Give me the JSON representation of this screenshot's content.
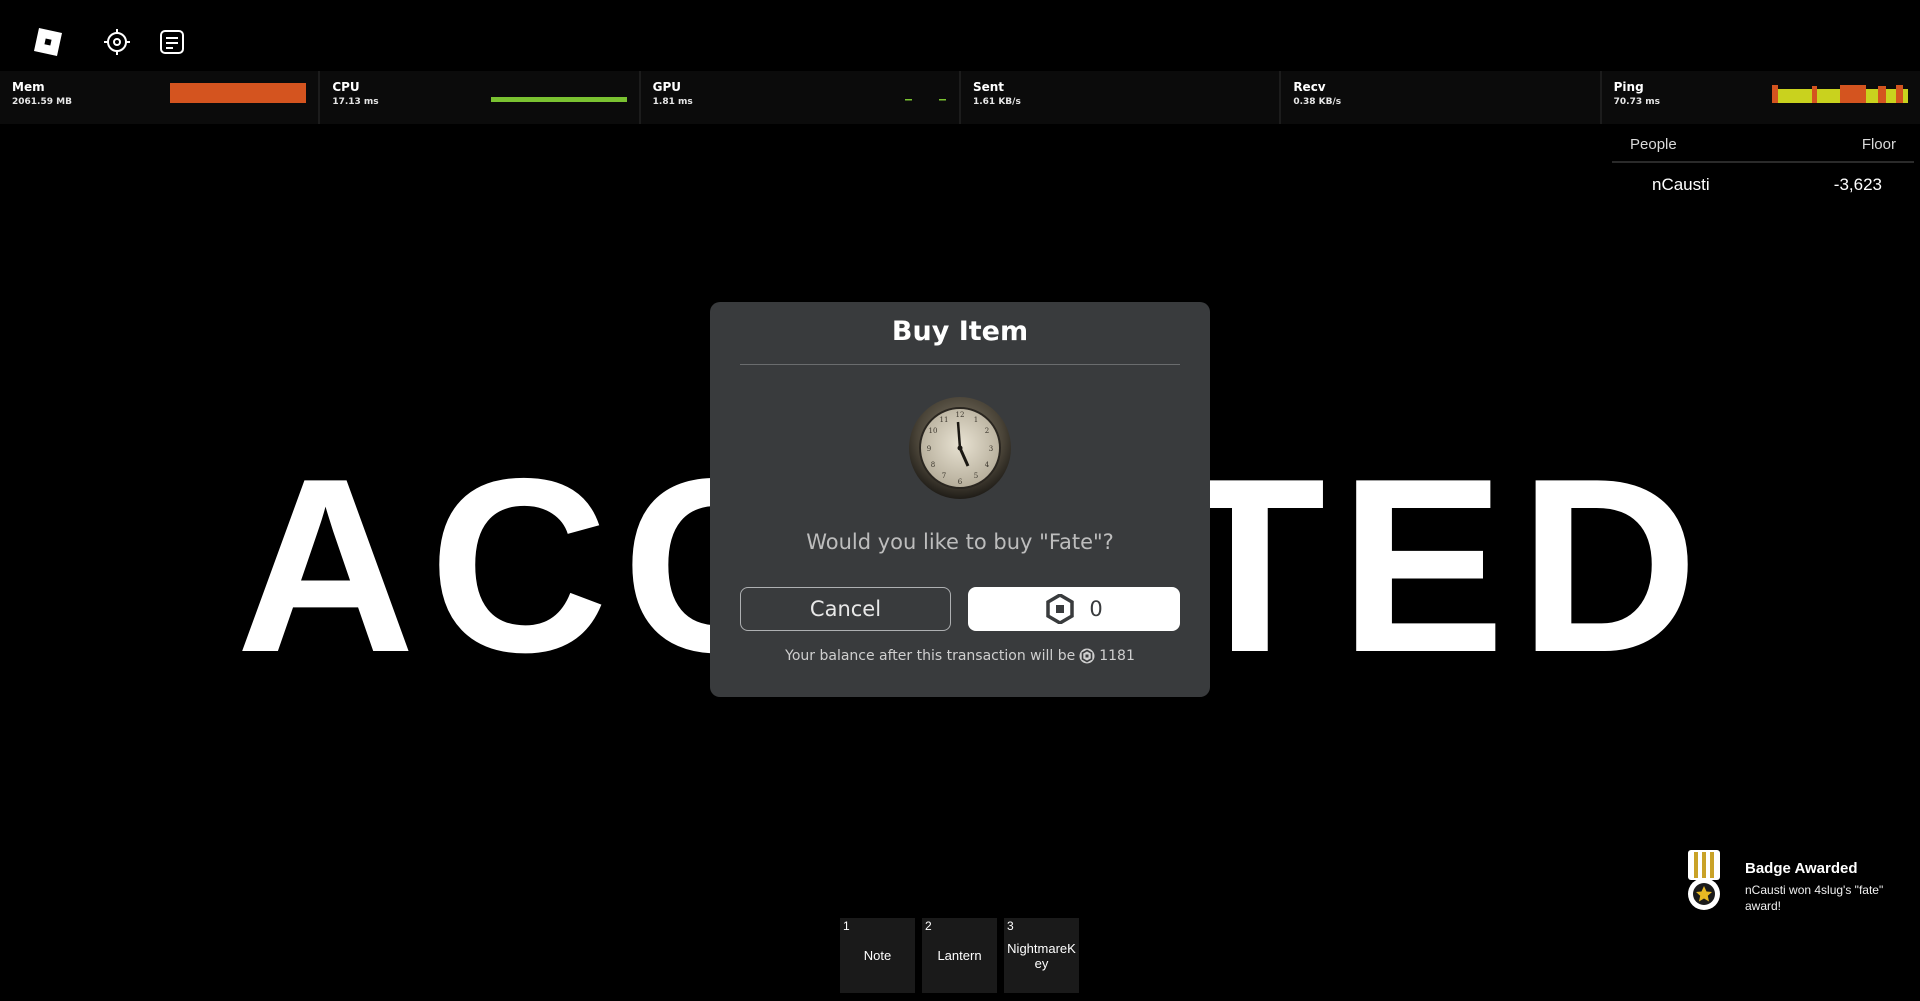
{
  "topbar": {
    "icons": [
      "roblox-logo-icon",
      "target-icon",
      "chat-icon"
    ]
  },
  "stats": [
    {
      "name": "Mem",
      "value": "2061.59 MB"
    },
    {
      "name": "CPU",
      "value": "17.13 ms"
    },
    {
      "name": "GPU",
      "value": "1.81 ms"
    },
    {
      "name": "Sent",
      "value": "1.61 KB/s"
    },
    {
      "name": "Recv",
      "value": "0.38 KB/s"
    },
    {
      "name": "Ping",
      "value": "70.73 ms"
    }
  ],
  "colors": {
    "mem_bar": "#d4541f",
    "cpu_bar": "#7ac231",
    "ping_bar": "#c9d21e",
    "ping_high": "#d4541f",
    "modal_bg": "#393b3d"
  },
  "leaderboard": {
    "header_people": "People",
    "header_floor": "Floor",
    "rows": [
      {
        "name": "nCausti",
        "floor": "-3,623"
      }
    ]
  },
  "background_text": "ACCEPTED",
  "modal": {
    "title": "Buy Item",
    "question": "Would you like to buy \"Fate\"?",
    "cancel_label": "Cancel",
    "price": "0",
    "balance_text": "Your balance after this transaction will be",
    "balance_value": "1181"
  },
  "hotbar": [
    {
      "num": "1",
      "name": "Note"
    },
    {
      "num": "2",
      "name": "Lantern"
    },
    {
      "num": "3",
      "name": "NightmareKey"
    }
  ],
  "badge": {
    "title": "Badge Awarded",
    "text": "nCausti won 4slug's \"fate\" award!"
  }
}
